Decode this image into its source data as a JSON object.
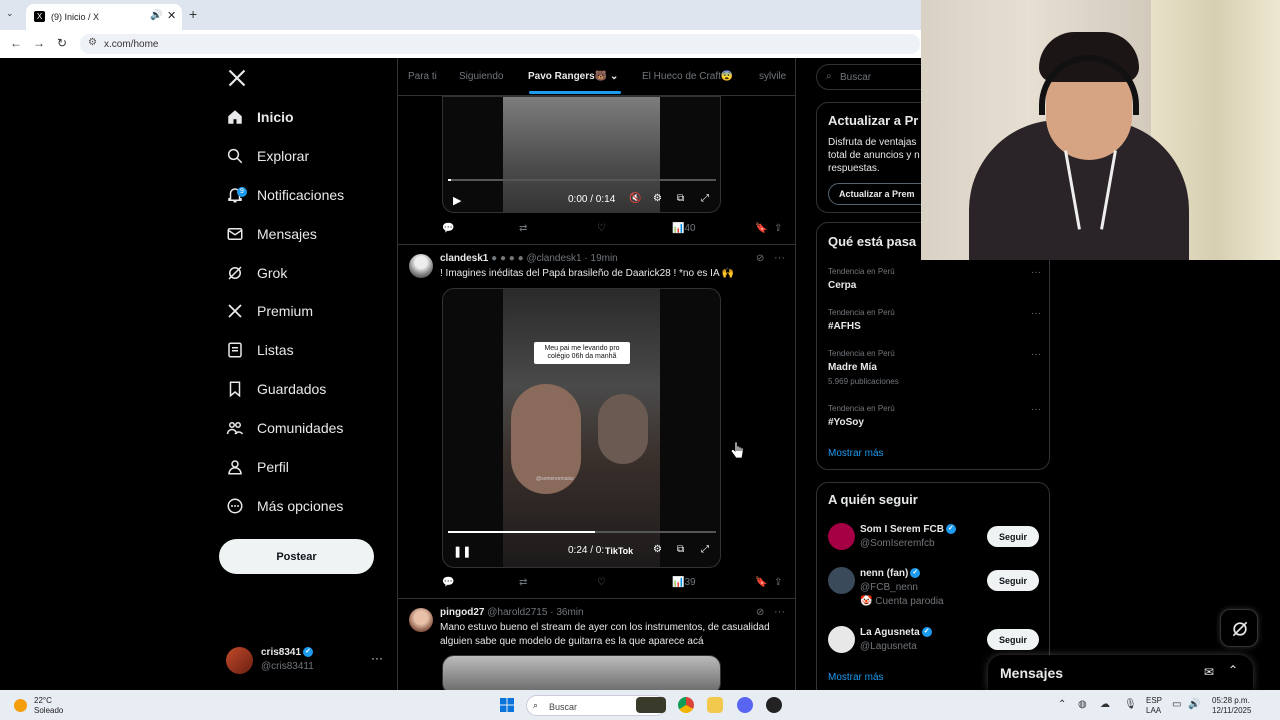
{
  "browser": {
    "tab_title": "(9) Inicio / X",
    "tab_favicon": "X",
    "url": "x.com/home"
  },
  "sidebar": {
    "items": [
      {
        "label": "Inicio",
        "icon": "home-icon"
      },
      {
        "label": "Explorar",
        "icon": "search-icon"
      },
      {
        "label": "Notificaciones",
        "icon": "bell-icon"
      },
      {
        "label": "Mensajes",
        "icon": "mail-icon"
      },
      {
        "label": "Grok",
        "icon": "grok-icon"
      },
      {
        "label": "Premium",
        "icon": "x-logo-icon"
      },
      {
        "label": "Listas",
        "icon": "list-icon"
      },
      {
        "label": "Guardados",
        "icon": "bookmark-icon"
      },
      {
        "label": "Comunidades",
        "icon": "people-icon"
      },
      {
        "label": "Perfil",
        "icon": "person-icon"
      },
      {
        "label": "Más opciones",
        "icon": "more-circle-icon"
      }
    ],
    "notification_badge": "9",
    "post_button": "Postear",
    "account": {
      "name": "cris8341",
      "handle": "@cris83411"
    }
  },
  "feed": {
    "tabs": [
      "Para ti",
      "Siguiendo",
      "Pavo Rangers🐻",
      "El Hueco de Craft😨",
      "sylvile"
    ],
    "posts": [
      {
        "video_time": "0:00 / 0:14",
        "views": "40"
      },
      {
        "name": "clandesk1",
        "handle": "@clandesk1 · 19min",
        "text": "! Imagines inéditas del Papá brasileño de Daarick28 ! *no es IA 🙌",
        "video_caption": "Meu pai me levando pro colégio 06h da manhã",
        "watermark": "@somenormaiss",
        "video_time": "0:24 / 0:",
        "tiktok": "TikTok",
        "views": "39"
      },
      {
        "name": "pingod27",
        "handle": "@harold2715 · 36min",
        "text": "Mano estuvo bueno el stream de ayer con los instrumentos, de casualidad alguien sabe que modelo de guitarra es la que aparece acá"
      }
    ]
  },
  "right": {
    "search_placeholder": "Buscar",
    "premium": {
      "title": "Actualizar a Pr",
      "body": [
        "Disfruta de ventajas",
        "total de anuncios y n",
        "respuestas."
      ],
      "button": "Actualizar a Prem"
    },
    "trends_title": "Qué está pasa",
    "trends": [
      {
        "context": "Tendencia en Perú",
        "title": "Cerpa",
        "count": ""
      },
      {
        "context": "Tendencia en Perú",
        "title": "#AFHS",
        "count": ""
      },
      {
        "context": "Tendencia en Perú",
        "title": "Madre Mía",
        "count": "5.969 publicaciones"
      },
      {
        "context": "Tendencia en Perú",
        "title": "#YoSoy",
        "count": ""
      }
    ],
    "show_more": "Mostrar más",
    "who_to_follow_title": "A quién seguir",
    "follows": [
      {
        "name": "Som I Serem FCB",
        "handle": "@SomIseremfcb",
        "extra": "",
        "color": "#a50044"
      },
      {
        "name": "nenn (fan)",
        "handle": "@FCB_nenn",
        "extra": "🤡 Cuenta parodia",
        "color": "#3a4a5a"
      },
      {
        "name": "La Agusneta",
        "handle": "@Lagusneta",
        "extra": "",
        "color": "#e8e8e8"
      }
    ],
    "follow_label": "Seguir",
    "show_more_2": "Mostrar más"
  },
  "messages_drawer": {
    "title": "Mensajes"
  },
  "taskbar": {
    "temp": "22°C",
    "weather": "Soleado",
    "search": "Buscar",
    "lang1": "ESP",
    "lang2": "LAA",
    "time": "05:28 p.m.",
    "date": "12/11/2025"
  },
  "colors": {
    "accent": "#1d9bf0",
    "background": "#000000",
    "border": "#2f3336",
    "muted": "#71767b"
  }
}
